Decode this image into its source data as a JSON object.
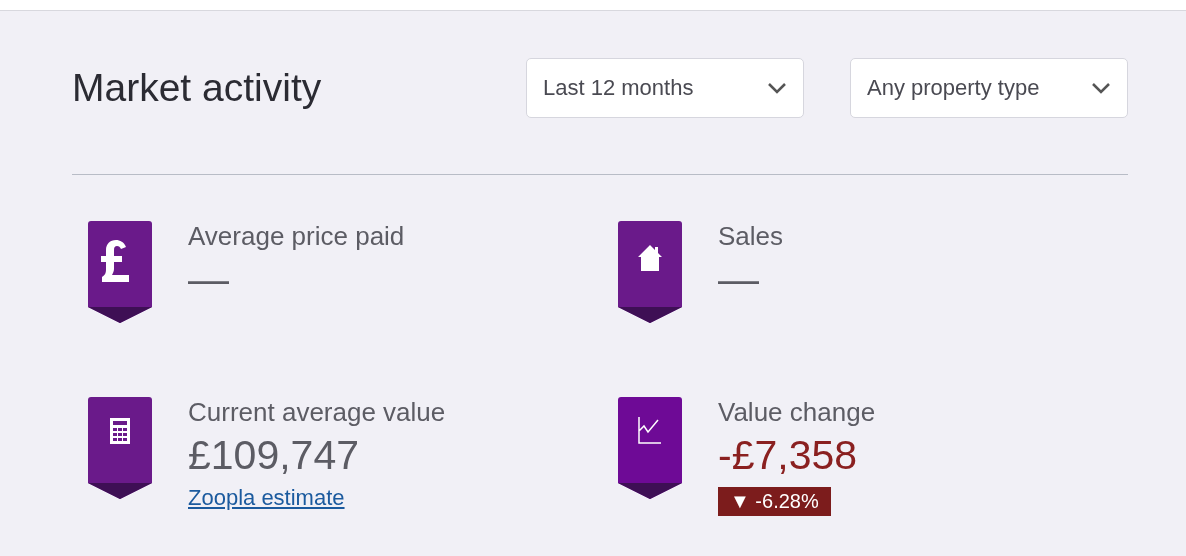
{
  "title": "Market activity",
  "filters": [
    {
      "value": "Last 12 months"
    },
    {
      "value": "Any property type"
    }
  ],
  "stats": [
    {
      "kind": "pound",
      "label": "Average price paid",
      "value": "—",
      "negative": false
    },
    {
      "kind": "house",
      "label": "Sales",
      "value": "—",
      "negative": false
    },
    {
      "kind": "calculator",
      "label": "Current average value",
      "value": "£109,747",
      "negative": false,
      "link": "Zoopla estimate"
    },
    {
      "kind": "chart",
      "label": "Value change",
      "value": "-£7,358",
      "negative": true,
      "change": {
        "arrow": "▼",
        "text": "-6.28%"
      }
    }
  ]
}
